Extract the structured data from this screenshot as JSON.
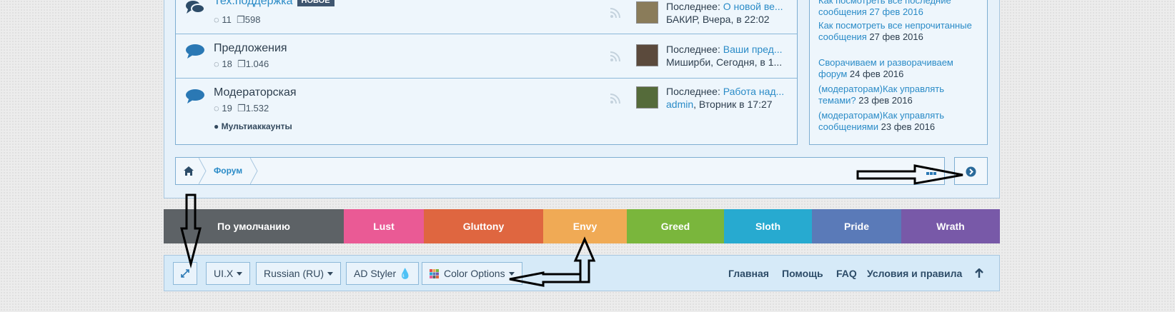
{
  "forums": [
    {
      "title": "Тех.поддержка",
      "badge": "НОВОЕ",
      "replies": "11",
      "messages": "598",
      "last_prefix": "Последнее:",
      "last_thread": "О новой ве...",
      "last_user": "БАКИР",
      "last_time": ", Вчера, в 22:02"
    },
    {
      "title": "Предложения",
      "replies": "18",
      "messages": "1.046",
      "last_prefix": "Последнее:",
      "last_thread": "Ваши пред...",
      "last_user": "Миширби",
      "last_time": ", Сегодня, в 1..."
    },
    {
      "title": "Модераторская",
      "replies": "19",
      "messages": "1.532",
      "subforum": "Мультиаккаунты",
      "last_prefix": "Последнее:",
      "last_thread": "Работа над...",
      "last_user": "admin",
      "last_time": ", Вторник в 17:27"
    }
  ],
  "sidebar": {
    "items": [
      {
        "link": "Как посмотреть все последние",
        "rest": "сообщения 27 фев 2016"
      },
      {
        "link": "Как посмотреть все непрочитанные сообщения",
        "rest": " 27 фев 2016"
      },
      {
        "link": "Сворачиваем и разворачиваем форум",
        "rest": " 24 фев 2016"
      },
      {
        "link": "(модераторам)Как управлять темами?",
        "rest": " 23 фев 2016"
      },
      {
        "link": "(модераторам)Как управлять сообщениями",
        "rest": " 23 фев 2016"
      }
    ]
  },
  "breadcrumb": {
    "home_icon": "home-icon",
    "forum": "Форум"
  },
  "styles": [
    {
      "label": "По умолчанию",
      "color": "#5d6266"
    },
    {
      "label": "Lust",
      "color": "#ea5a95"
    },
    {
      "label": "Gluttony",
      "color": "#df6640"
    },
    {
      "label": "Envy",
      "color": "#f0aa55"
    },
    {
      "label": "Greed",
      "color": "#7ab63c"
    },
    {
      "label": "Sloth",
      "color": "#27aad0"
    },
    {
      "label": "Pride",
      "color": "#5a7ab8"
    },
    {
      "label": "Wrath",
      "color": "#7859a8"
    }
  ],
  "footer": {
    "uix": "UI.X",
    "language": "Russian (RU)",
    "ad_styler": "AD Styler",
    "color_options": "Color Options",
    "links": [
      "Главная",
      "Помощь",
      "FAQ",
      "Условия и правила"
    ]
  },
  "colors": {
    "link": "#2a8bc7",
    "border": "#7eaed2",
    "panel": "#e6f1fa"
  }
}
